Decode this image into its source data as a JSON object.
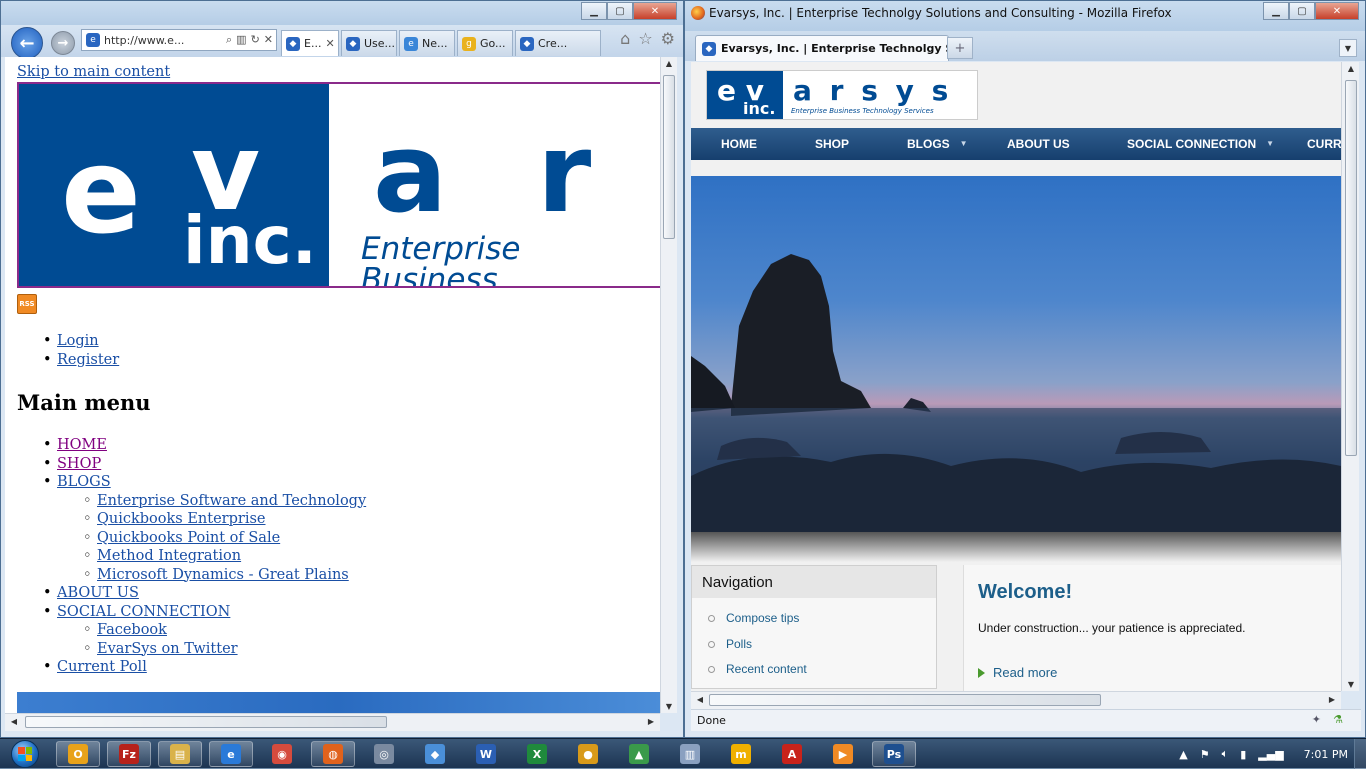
{
  "ie": {
    "address": "http://www.e...",
    "tabs": [
      {
        "label": "E...",
        "active": true
      },
      {
        "label": "Use..."
      },
      {
        "label": "Ne..."
      },
      {
        "label": "Go..."
      },
      {
        "label": "Cre..."
      }
    ],
    "content": {
      "skip_link": "Skip to main content",
      "banner": {
        "letters": [
          "e",
          "v",
          "a",
          "r"
        ],
        "inc": "inc.",
        "tagline": "Enterprise Business"
      },
      "rss": "RSS",
      "user_links": [
        "Login",
        "Register"
      ],
      "main_menu_title": "Main menu",
      "menu": [
        {
          "label": "HOME",
          "visited": true
        },
        {
          "label": "SHOP",
          "visited": true
        },
        {
          "label": "BLOGS",
          "children": [
            "Enterprise Software and Technology",
            "Quickbooks Enterprise",
            "Quickbooks Point of Sale",
            "Method Integration",
            "Microsoft Dynamics - Great Plains"
          ]
        },
        {
          "label": "ABOUT US"
        },
        {
          "label": "SOCIAL CONNECTION",
          "children": [
            "Facebook",
            "EvarSys on Twitter"
          ]
        },
        {
          "label": "Current Poll"
        }
      ]
    }
  },
  "ff": {
    "window_title": "Evarsys, Inc. | Enterprise Technolgy Solutions and Consulting - Mozilla Firefox",
    "tab_label": "Evarsys, Inc. | Enterprise Technolgy S...",
    "new_tab": "+",
    "logo": {
      "ev": "e v",
      "inc": "inc.",
      "arsys": "a r s y s",
      "tagline": "Enterprise Business Technology Services"
    },
    "menu": [
      "HOME",
      "SHOP",
      "BLOGS",
      "ABOUT US",
      "SOCIAL CONNECTION",
      "CURR"
    ],
    "navigation": {
      "title": "Navigation",
      "items": [
        "Compose tips",
        "Polls",
        "Recent content"
      ]
    },
    "welcome": {
      "title": "Welcome!",
      "text": "Under construction... your patience is appreciated.",
      "read_more": "Read more"
    },
    "status": "Done"
  },
  "taskbar": {
    "clock": "7:01 PM",
    "apps": [
      {
        "name": "outlook",
        "letter": "O",
        "color": "#e8a21a"
      },
      {
        "name": "filezilla",
        "letter": "Fz",
        "color": "#b7221b"
      },
      {
        "name": "explorer",
        "letter": "▤",
        "color": "#d9b24a"
      },
      {
        "name": "internet-explorer",
        "letter": "e",
        "color": "#2a7ad8"
      },
      {
        "name": "chrome",
        "letter": "◉",
        "color": "#d54b3d"
      },
      {
        "name": "firefox",
        "letter": "◍",
        "color": "#e0621c"
      },
      {
        "name": "network",
        "letter": "◎",
        "color": "#7a8aa0"
      },
      {
        "name": "notes",
        "letter": "◆",
        "color": "#4a8fd8"
      },
      {
        "name": "word",
        "letter": "W",
        "color": "#2b5fb3"
      },
      {
        "name": "excel",
        "letter": "X",
        "color": "#1f8a3c"
      },
      {
        "name": "media",
        "letter": "●",
        "color": "#d89a1a"
      },
      {
        "name": "chart",
        "letter": "▲",
        "color": "#3a9a4a"
      },
      {
        "name": "doc",
        "letter": "▥",
        "color": "#8aa0c0"
      },
      {
        "name": "meebo",
        "letter": "m",
        "color": "#f0b000"
      },
      {
        "name": "pdf",
        "letter": "A",
        "color": "#c8231b"
      },
      {
        "name": "player",
        "letter": "▶",
        "color": "#f08a24"
      },
      {
        "name": "photoshop",
        "letter": "Ps",
        "color": "#1e4f8f"
      }
    ]
  }
}
